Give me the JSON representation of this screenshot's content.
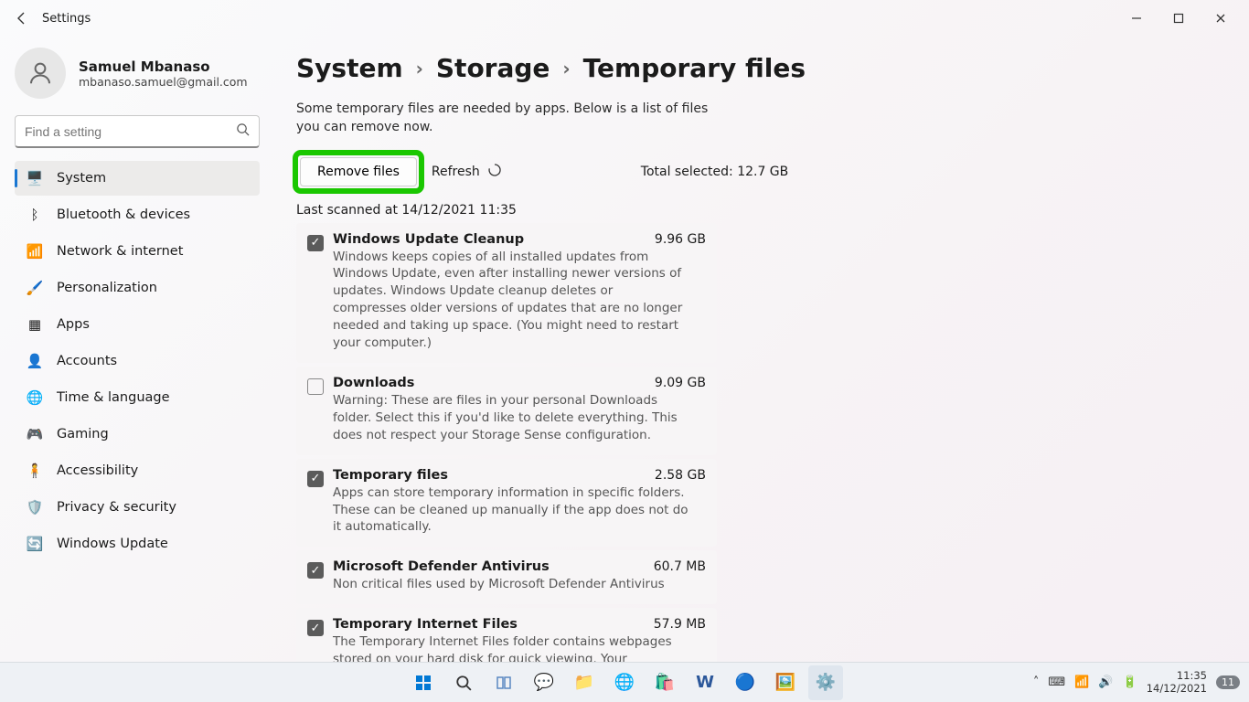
{
  "window": {
    "title": "Settings"
  },
  "profile": {
    "name": "Samuel Mbanaso",
    "email": "mbanaso.samuel@gmail.com"
  },
  "search": {
    "placeholder": "Find a setting"
  },
  "nav": [
    {
      "label": "System",
      "icon": "🖥️",
      "active": true,
      "key": "system"
    },
    {
      "label": "Bluetooth & devices",
      "icon": "ᛒ",
      "active": false,
      "key": "bluetooth"
    },
    {
      "label": "Network & internet",
      "icon": "📶",
      "active": false,
      "key": "network"
    },
    {
      "label": "Personalization",
      "icon": "🖌️",
      "active": false,
      "key": "personalization"
    },
    {
      "label": "Apps",
      "icon": "▦",
      "active": false,
      "key": "apps"
    },
    {
      "label": "Accounts",
      "icon": "👤",
      "active": false,
      "key": "accounts"
    },
    {
      "label": "Time & language",
      "icon": "🌐",
      "active": false,
      "key": "time"
    },
    {
      "label": "Gaming",
      "icon": "🎮",
      "active": false,
      "key": "gaming"
    },
    {
      "label": "Accessibility",
      "icon": "🧍",
      "active": false,
      "key": "accessibility"
    },
    {
      "label": "Privacy & security",
      "icon": "🛡️",
      "active": false,
      "key": "privacy"
    },
    {
      "label": "Windows Update",
      "icon": "🔄",
      "active": false,
      "key": "update"
    }
  ],
  "breadcrumb": {
    "p1": "System",
    "p2": "Storage",
    "p3": "Temporary files"
  },
  "subtitle": "Some temporary files are needed by apps. Below is a list of files you can remove now.",
  "actions": {
    "remove": "Remove files",
    "refresh": "Refresh",
    "total_label": "Total selected:",
    "total_value": "12.7 GB",
    "last_scanned": "Last scanned at 14/12/2021 11:35"
  },
  "items": [
    {
      "title": "Windows Update Cleanup",
      "size": "9.96 GB",
      "checked": true,
      "desc": "Windows keeps copies of all installed updates from Windows Update, even after installing newer versions of updates. Windows Update cleanup deletes or compresses older versions of updates that are no longer needed and taking up space. (You might need to restart your computer.)"
    },
    {
      "title": "Downloads",
      "size": "9.09 GB",
      "checked": false,
      "desc": "Warning: These are files in your personal Downloads folder. Select this if you'd like to delete everything. This does not respect your Storage Sense configuration."
    },
    {
      "title": "Temporary files",
      "size": "2.58 GB",
      "checked": true,
      "desc": "Apps can store temporary information in specific folders. These can be cleaned up manually if the app does not do it automatically."
    },
    {
      "title": "Microsoft Defender Antivirus",
      "size": "60.7 MB",
      "checked": true,
      "desc": "Non critical files used by Microsoft Defender Antivirus"
    },
    {
      "title": "Temporary Internet Files",
      "size": "57.9 MB",
      "checked": true,
      "desc": "The Temporary Internet Files folder contains webpages stored on your hard disk for quick viewing. Your personalized settings for webpages will be left intact."
    }
  ],
  "tray": {
    "time": "11:35",
    "date": "14/12/2021",
    "badge": "11"
  }
}
